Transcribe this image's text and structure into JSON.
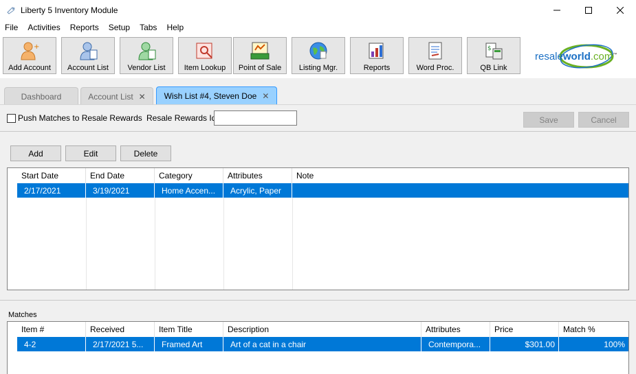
{
  "window": {
    "title": "Liberty 5 Inventory Module"
  },
  "menu": [
    "File",
    "Activities",
    "Reports",
    "Setup",
    "Tabs",
    "Help"
  ],
  "toolbar": [
    {
      "label": "Add Account",
      "icon": "add-account-icon"
    },
    {
      "label": "Account List",
      "icon": "account-list-icon"
    },
    {
      "label": "Vendor List",
      "icon": "vendor-list-icon"
    },
    {
      "label": "Item Lookup",
      "icon": "item-lookup-icon"
    },
    {
      "label": "Point of Sale",
      "icon": "point-of-sale-icon"
    },
    {
      "label": "Listing Mgr.",
      "icon": "listing-manager-icon"
    },
    {
      "label": "Reports",
      "icon": "reports-icon"
    },
    {
      "label": "Word Proc.",
      "icon": "word-processor-icon"
    },
    {
      "label": "QB Link",
      "icon": "qb-link-icon"
    }
  ],
  "logo": {
    "part1": "resale",
    "part2": "world",
    "part3": ".com",
    "tm": "™"
  },
  "tabs": [
    {
      "label": "Dashboard",
      "closable": false,
      "active": false
    },
    {
      "label": "Account List",
      "closable": true,
      "active": false
    },
    {
      "label": "Wish List #4, Steven Doe",
      "closable": true,
      "active": true
    }
  ],
  "options": {
    "push_matches_label": "Push Matches to Resale Rewards",
    "push_matches_checked": false,
    "resale_rewards_label": "Resale Rewards Id",
    "resale_rewards_value": "",
    "save_label": "Save",
    "cancel_label": "Cancel"
  },
  "actions": {
    "add": "Add",
    "edit": "Edit",
    "delete": "Delete"
  },
  "wishlist": {
    "columns": [
      "Start Date",
      "End Date",
      "Category",
      "Attributes",
      "Note"
    ],
    "rows": [
      [
        "2/17/2021",
        "3/19/2021",
        "Home Accen...",
        "Acrylic, Paper",
        ""
      ]
    ]
  },
  "matches": {
    "label": "Matches",
    "columns": [
      "Item #",
      "Received",
      "Item Title",
      "Description",
      "Attributes",
      "Price",
      "Match %"
    ],
    "rows": [
      [
        "4-2",
        "2/17/2021 5...",
        "Framed Art",
        "Art of a cat in a chair",
        "Contempora...",
        "$301.00",
        "100%"
      ]
    ]
  },
  "colors": {
    "selection": "#0078d7",
    "active_tab": "#99d1ff",
    "logo_blue": "#1a6fc4",
    "logo_green": "#6ab023"
  }
}
